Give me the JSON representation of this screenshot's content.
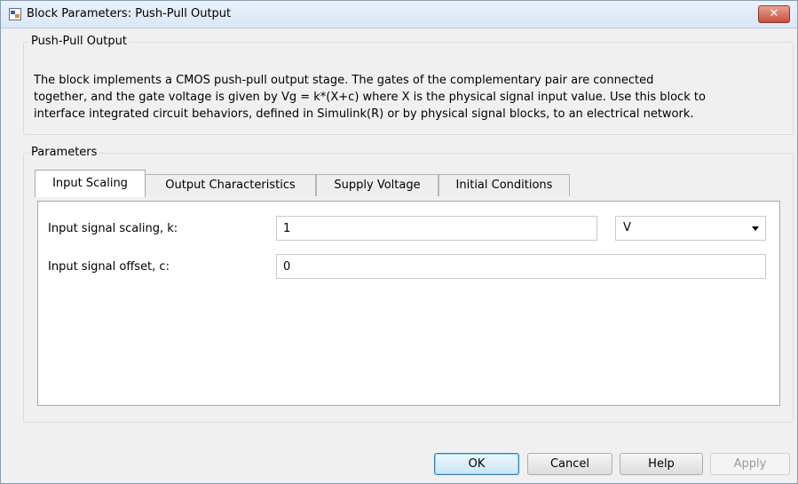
{
  "window": {
    "title": "Block Parameters: Push-Pull Output"
  },
  "block": {
    "name": "Push-Pull Output",
    "description_lines": [
      "The block implements a CMOS push-pull output stage. The gates of the complementary pair are connected",
      "together, and the gate voltage is given by Vg = k*(X+c) where X is the physical signal input value. Use this block to",
      "interface integrated circuit behaviors, defined in Simulink(R) or by physical signal blocks, to an electrical network."
    ]
  },
  "parameters": {
    "label": "Parameters",
    "tabs": [
      {
        "label": "Input Scaling",
        "active": true
      },
      {
        "label": "Output Characteristics",
        "active": false
      },
      {
        "label": "Supply Voltage",
        "active": false
      },
      {
        "label": "Initial Conditions",
        "active": false
      }
    ],
    "fields": [
      {
        "label": "Input signal scaling, k:",
        "value": "1",
        "unit": "V"
      },
      {
        "label": "Input signal offset, c:",
        "value": "0"
      }
    ]
  },
  "buttons": {
    "ok": "OK",
    "cancel": "Cancel",
    "help": "Help",
    "apply": "Apply"
  },
  "icons": {
    "app": "simulink-block-icon",
    "close": "close-icon",
    "dropdown": "chevron-down-icon"
  },
  "colors": {
    "close_button": "#c74f3c",
    "titlebar": "#dbe7f6",
    "default_button_border": "#3c7fb1"
  }
}
